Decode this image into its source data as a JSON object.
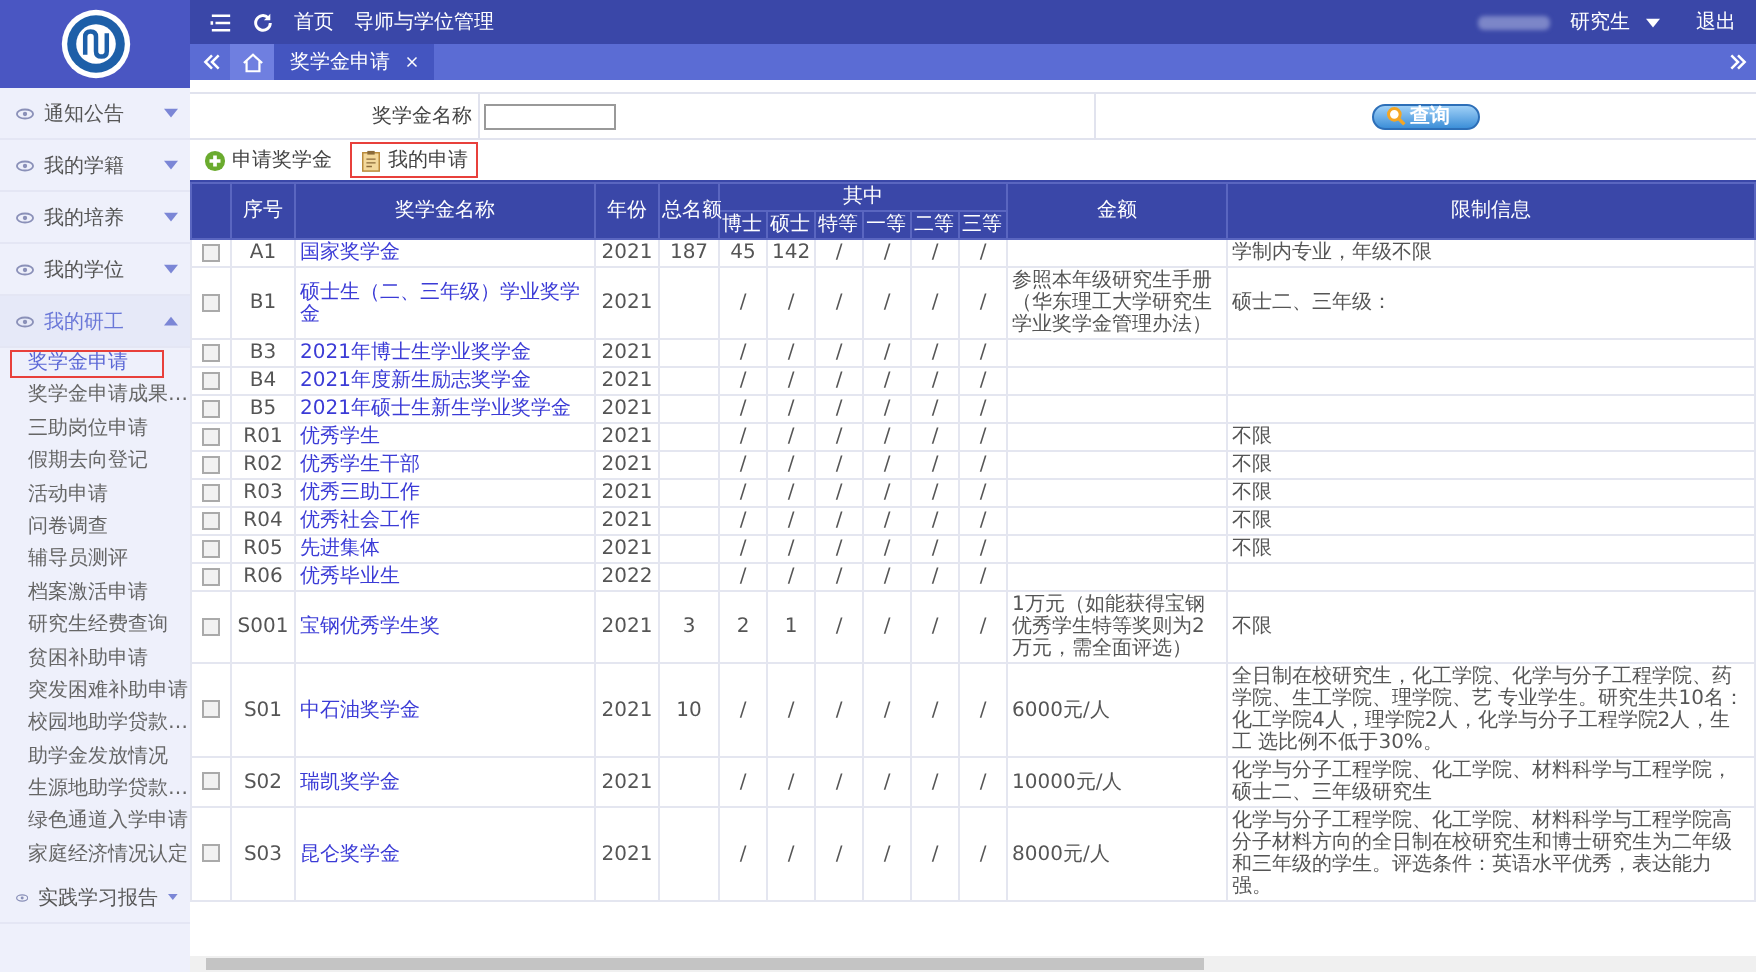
{
  "top_bar": {
    "nav": [
      "首页",
      "导师与学位管理"
    ],
    "role": "研究生",
    "logout": "退出"
  },
  "tabs": [
    {
      "label": "奖学金申请",
      "selected": true
    }
  ],
  "sidebar": {
    "groups": [
      {
        "label": "通知公告",
        "expanded": false
      },
      {
        "label": "我的学籍",
        "expanded": false
      },
      {
        "label": "我的培养",
        "expanded": false
      },
      {
        "label": "我的学位",
        "expanded": false
      },
      {
        "label": "我的研工",
        "expanded": true,
        "children": [
          {
            "label": "奖学金申请",
            "selected": true,
            "highlighted": true
          },
          {
            "label": "奖学金申请成果…",
            "selected": false,
            "highlighted": false
          },
          {
            "label": "三助岗位申请",
            "selected": false,
            "highlighted": false
          },
          {
            "label": "假期去向登记",
            "selected": false,
            "highlighted": false
          },
          {
            "label": "活动申请",
            "selected": false,
            "highlighted": false
          },
          {
            "label": "问卷调查",
            "selected": false,
            "highlighted": false
          },
          {
            "label": "辅导员测评",
            "selected": false,
            "highlighted": false
          },
          {
            "label": "档案激活申请",
            "selected": false,
            "highlighted": false
          },
          {
            "label": "研究生经费查询",
            "selected": false,
            "highlighted": false
          },
          {
            "label": "贫困补助申请",
            "selected": false,
            "highlighted": false
          },
          {
            "label": "突发困难补助申请",
            "selected": false,
            "highlighted": false
          },
          {
            "label": "校园地助学贷款…",
            "selected": false,
            "highlighted": false
          },
          {
            "label": "助学金发放情况",
            "selected": false,
            "highlighted": false
          },
          {
            "label": "生源地助学贷款…",
            "selected": false,
            "highlighted": false
          },
          {
            "label": "绿色通道入学申请",
            "selected": false,
            "highlighted": false
          },
          {
            "label": "家庭经济情况认定",
            "selected": false,
            "highlighted": false
          }
        ]
      },
      {
        "label": "实践学习报告",
        "expanded": false
      }
    ]
  },
  "search": {
    "label": "奖学金名称",
    "button": "查询"
  },
  "toolbar": [
    {
      "kind": "add",
      "label": "申请奖学金",
      "highlighted": false
    },
    {
      "kind": "list",
      "label": "我的申请",
      "highlighted": true
    }
  ],
  "table": {
    "columns": [
      "序号",
      "奖学金名称",
      "年份",
      "总名额"
    ],
    "group_header": "其中",
    "sub_columns": [
      "博士",
      "硕士",
      "特等",
      "一等",
      "二等",
      "三等"
    ],
    "tail_columns": [
      "金额",
      "限制信息"
    ],
    "rows": [
      {
        "checked": false,
        "code": "A1",
        "name": "国家奖学金",
        "year": "2021",
        "total": "187",
        "counts": [
          "45",
          "142",
          "/",
          "/",
          "/",
          "/"
        ],
        "amount": "",
        "restriction": "学制内专业，年级不限"
      },
      {
        "checked": false,
        "code": "B1",
        "name": "硕士生（二、三年级）学业奖学金",
        "year": "2021",
        "total": "",
        "counts": [
          "/",
          "/",
          "/",
          "/",
          "/",
          "/"
        ],
        "amount": "参照本年级研究生手册（华东理工大学研究生学业奖学金管理办法）",
        "restriction": "硕士二、三年级："
      },
      {
        "checked": false,
        "code": "B3",
        "name": "2021年博士生学业奖学金",
        "year": "2021",
        "total": "",
        "counts": [
          "/",
          "/",
          "/",
          "/",
          "/",
          "/"
        ],
        "amount": "",
        "restriction": ""
      },
      {
        "checked": false,
        "code": "B4",
        "name": "2021年度新生励志奖学金",
        "year": "2021",
        "total": "",
        "counts": [
          "/",
          "/",
          "/",
          "/",
          "/",
          "/"
        ],
        "amount": "",
        "restriction": ""
      },
      {
        "checked": false,
        "code": "B5",
        "name": "2021年硕士生新生学业奖学金",
        "year": "2021",
        "total": "",
        "counts": [
          "/",
          "/",
          "/",
          "/",
          "/",
          "/"
        ],
        "amount": "",
        "restriction": ""
      },
      {
        "checked": false,
        "code": "R01",
        "name": "优秀学生",
        "year": "2021",
        "total": "",
        "counts": [
          "/",
          "/",
          "/",
          "/",
          "/",
          "/"
        ],
        "amount": "",
        "restriction": "不限"
      },
      {
        "checked": false,
        "code": "R02",
        "name": "优秀学生干部",
        "year": "2021",
        "total": "",
        "counts": [
          "/",
          "/",
          "/",
          "/",
          "/",
          "/"
        ],
        "amount": "",
        "restriction": "不限"
      },
      {
        "checked": false,
        "code": "R03",
        "name": "优秀三助工作",
        "year": "2021",
        "total": "",
        "counts": [
          "/",
          "/",
          "/",
          "/",
          "/",
          "/"
        ],
        "amount": "",
        "restriction": "不限"
      },
      {
        "checked": false,
        "code": "R04",
        "name": "优秀社会工作",
        "year": "2021",
        "total": "",
        "counts": [
          "/",
          "/",
          "/",
          "/",
          "/",
          "/"
        ],
        "amount": "",
        "restriction": "不限"
      },
      {
        "checked": false,
        "code": "R05",
        "name": "先进集体",
        "year": "2021",
        "total": "",
        "counts": [
          "/",
          "/",
          "/",
          "/",
          "/",
          "/"
        ],
        "amount": "",
        "restriction": "不限"
      },
      {
        "checked": false,
        "code": "R06",
        "name": "优秀毕业生",
        "year": "2022",
        "total": "",
        "counts": [
          "/",
          "/",
          "/",
          "/",
          "/",
          "/"
        ],
        "amount": "",
        "restriction": ""
      },
      {
        "checked": false,
        "code": "S001",
        "name": "宝钢优秀学生奖",
        "year": "2021",
        "total": "3",
        "counts": [
          "2",
          "1",
          "/",
          "/",
          "/",
          "/"
        ],
        "amount": "1万元（如能获得宝钢优秀学生特等奖则为2万元，需全面评选）",
        "restriction": "不限"
      },
      {
        "checked": false,
        "code": "S01",
        "name": "中石油奖学金",
        "year": "2021",
        "total": "10",
        "counts": [
          "/",
          "/",
          "/",
          "/",
          "/",
          "/"
        ],
        "amount": "6000元/人",
        "restriction": "全日制在校研究生，化工学院、化学与分子工程学院、药学院、生工学院、理学院、艺 专业学生。研究生共10名：化工学院4人，理学院2人，化学与分子工程学院2人，生工 选比例不低于30%。"
      },
      {
        "checked": false,
        "code": "S02",
        "name": "瑞凯奖学金",
        "year": "2021",
        "total": "",
        "counts": [
          "/",
          "/",
          "/",
          "/",
          "/",
          "/"
        ],
        "amount": "10000元/人",
        "restriction": "化学与分子工程学院、化工学院、材料科学与工程学院，硕士二、三年级研究生"
      },
      {
        "checked": false,
        "code": "S03",
        "name": "昆仑奖学金",
        "year": "2021",
        "total": "",
        "counts": [
          "/",
          "/",
          "/",
          "/",
          "/",
          "/"
        ],
        "amount": "8000元/人",
        "restriction": "化学与分子工程学院、化工学院、材料科学与工程学院高分子材料方向的全日制在校研究生和博士研究生为二年级和三年级的学生。评选条件：英语水平优秀，表达能力强。"
      }
    ]
  }
}
